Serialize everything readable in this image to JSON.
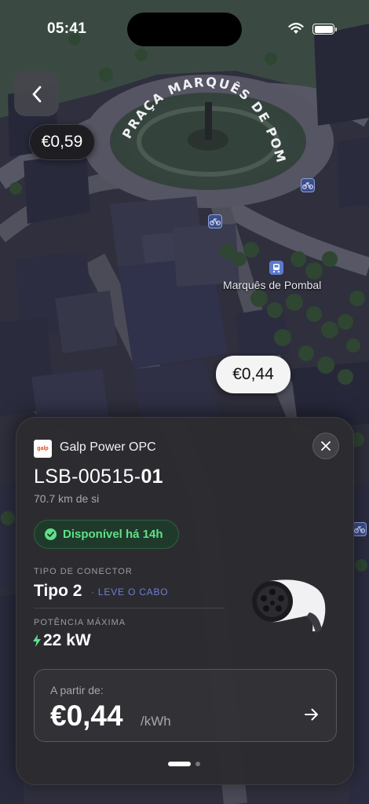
{
  "status_bar": {
    "time": "05:41"
  },
  "map": {
    "square_name": "PRAÇA MARQUÊS DE POMBAL",
    "place_label": "Marquês de Pombal",
    "pins": [
      {
        "price": "€0,59",
        "selected": false
      },
      {
        "price": "€0,44",
        "selected": true
      }
    ]
  },
  "card": {
    "operator": "Galp Power OPC",
    "logo_text": "galp",
    "station_id_prefix": "LSB-00515-",
    "station_id_suffix": "01",
    "distance": "70.7 km de si",
    "availability": "Disponível há 14h",
    "connector_label": "TIPO DE CONECTOR",
    "connector_type": "Tipo 2",
    "connector_note": "· LEVE O CABO",
    "power_label": "POTÊNCIA MÁXIMA",
    "power_value": "22 kW",
    "price_from_label": "A partir de:",
    "price": "€0,44",
    "price_unit": "/kWh",
    "pager": {
      "pages": 2,
      "current": 1
    }
  },
  "colors": {
    "available_green": "#5fe08a",
    "accent_blue": "#6b7fd8",
    "card_bg": "#2c2c30",
    "brand_orange": "#e8490f"
  }
}
